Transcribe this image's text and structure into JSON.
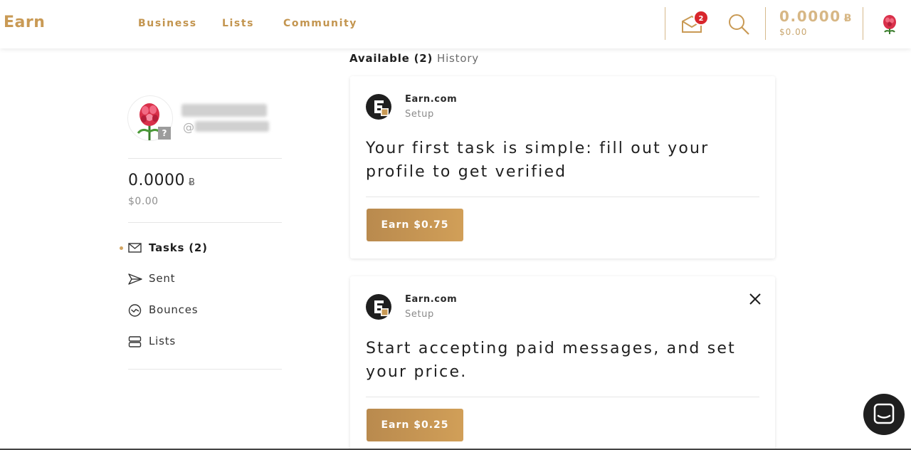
{
  "header": {
    "logo": "Earn",
    "nav": [
      "Business",
      "Lists",
      "Community"
    ],
    "unread_count": "2",
    "balance": "0.0000",
    "balance_unit": "Ƀ",
    "balance_usd": "$0.00"
  },
  "sidebar": {
    "username_prefix": "@",
    "balance": "0.0000",
    "balance_unit": "Ƀ",
    "balance_usd": "$0.00",
    "items": [
      {
        "label": "Tasks (2)",
        "icon": "mail-icon",
        "active": true
      },
      {
        "label": "Sent",
        "icon": "send-icon",
        "active": false
      },
      {
        "label": "Bounces",
        "icon": "bounce-icon",
        "active": false
      },
      {
        "label": "Lists",
        "icon": "list-icon",
        "active": false
      }
    ]
  },
  "tabs": {
    "available": "Available (2)",
    "history": "History"
  },
  "tasks": [
    {
      "sender": "Earn.com",
      "category": "Setup",
      "title": "Your first task is simple: fill out your profile to get verified",
      "button": "Earn $0.75",
      "closable": false
    },
    {
      "sender": "Earn.com",
      "category": "Setup",
      "title": "Start accepting paid messages, and set your price.",
      "button": "Earn $0.25",
      "closable": true
    }
  ],
  "colors": {
    "accent": "#c3954f",
    "button": "#c49352",
    "badge": "#d8262c"
  }
}
